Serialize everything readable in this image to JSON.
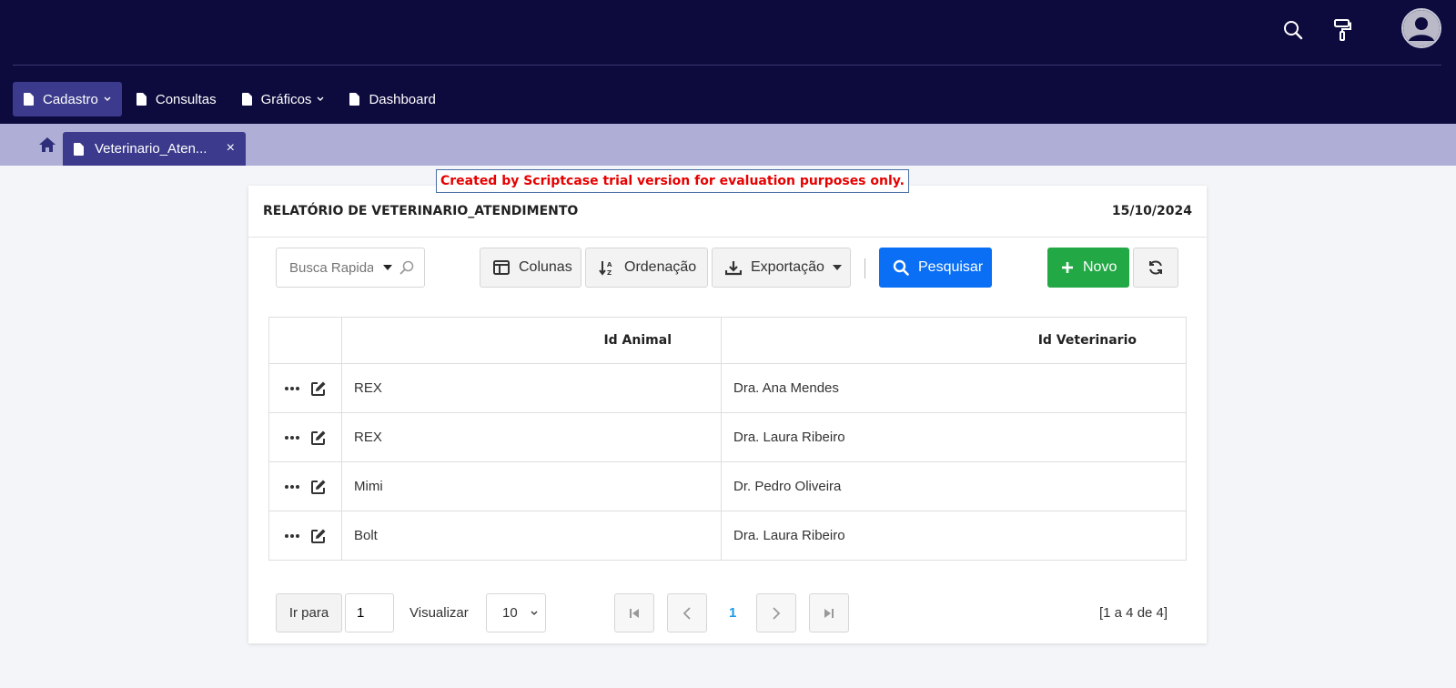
{
  "nav": {
    "items": [
      {
        "label": "Cadastro",
        "active": true,
        "dropdown": true
      },
      {
        "label": "Consultas",
        "active": false,
        "dropdown": false
      },
      {
        "label": "Gráficos",
        "active": false,
        "dropdown": true
      },
      {
        "label": "Dashboard",
        "active": false,
        "dropdown": false
      }
    ]
  },
  "tabs": [
    {
      "label": "Veterinario_Aten...",
      "close": "×"
    }
  ],
  "trial_notice": "Created by Scriptcase trial version for evaluation purposes only.",
  "report": {
    "title": "RELATÓRIO DE VETERINARIO_ATENDIMENTO",
    "date": "15/10/2024"
  },
  "toolbar": {
    "quick_search_placeholder": "Busca Rapida",
    "columns_label": "Colunas",
    "sort_label": "Ordenação",
    "export_label": "Exportação",
    "search_label": "Pesquisar",
    "new_label": "Novo"
  },
  "table": {
    "columns": [
      "Id Animal",
      "Id Veterinario"
    ],
    "rows": [
      [
        "REX",
        "Dra. Ana Mendes"
      ],
      [
        "REX",
        "Dra. Laura Ribeiro"
      ],
      [
        "Mimi",
        "Dr. Pedro Oliveira"
      ],
      [
        "Bolt",
        "Dra. Laura Ribeiro"
      ]
    ]
  },
  "pagination": {
    "goto_label": "Ir para",
    "goto_value": "1",
    "view_label": "Visualizar",
    "page_size": "10",
    "page_size_options": [
      "10"
    ],
    "current_page": "1",
    "summary": "[1 a 4 de 4]"
  },
  "colors": {
    "topbar": "#0d0a3e",
    "nav_active": "#3b3a8c",
    "tabbar": "#aeaed6",
    "primary": "#0a6ff5",
    "success": "#22a845",
    "trial_text": "#e60000",
    "page_link": "#1a9be8"
  },
  "icons": [
    "search-icon",
    "paint-roller-icon",
    "user-avatar-icon",
    "document-icon",
    "chevron-down-icon",
    "home-icon",
    "close-icon",
    "columns-icon",
    "sort-icon",
    "download-icon",
    "caret-down-icon",
    "plus-icon",
    "refresh-icon",
    "ellipsis-icon",
    "edit-icon",
    "first-page-icon",
    "previous-page-icon",
    "next-page-icon",
    "last-page-icon"
  ]
}
